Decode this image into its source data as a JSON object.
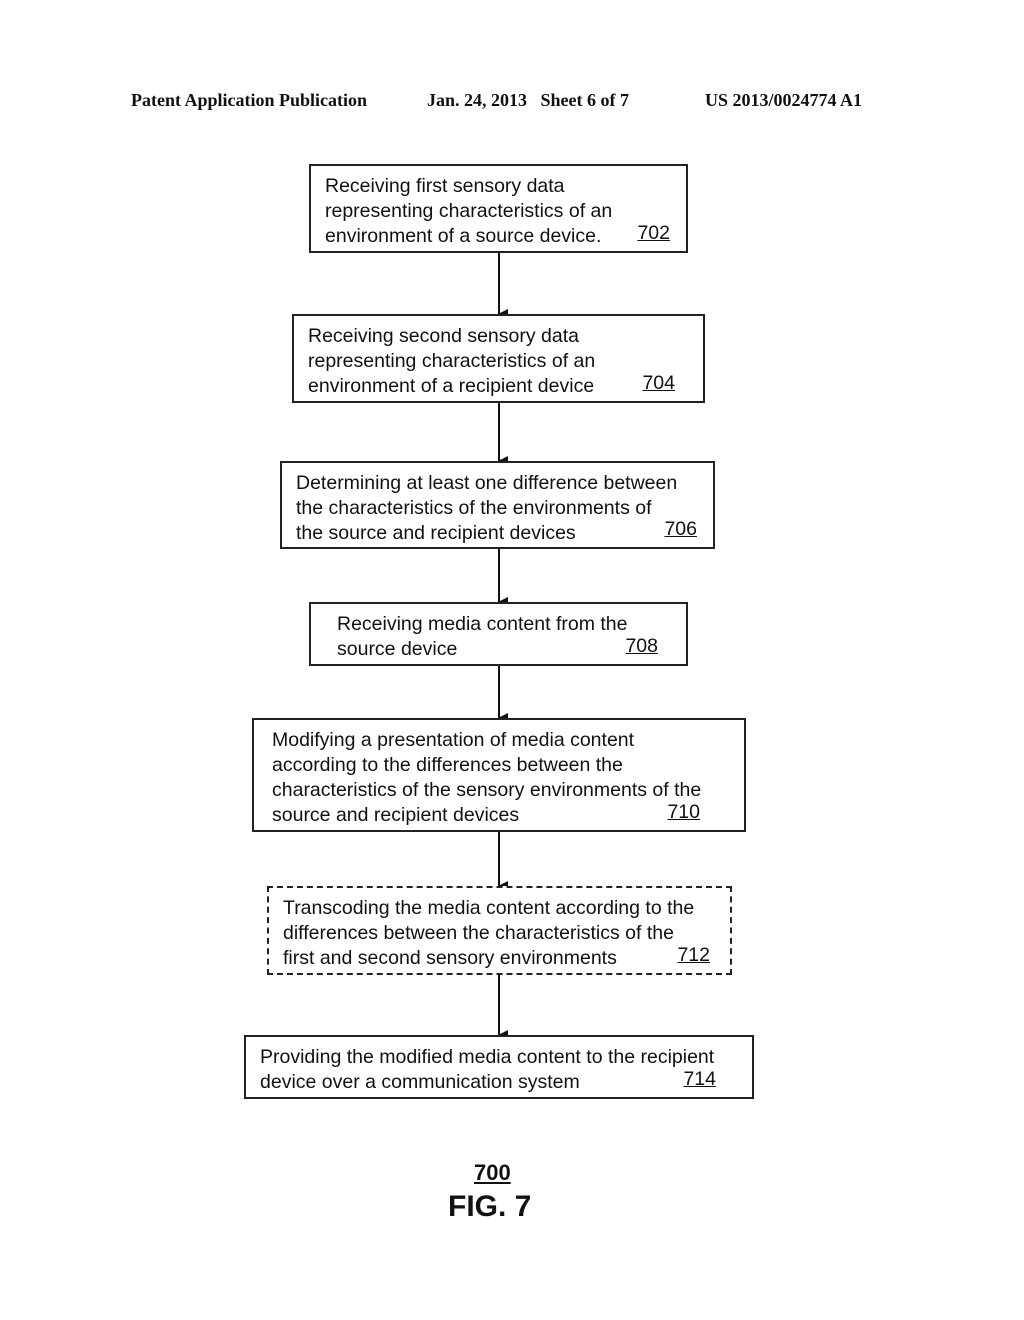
{
  "header": {
    "publication": "Patent Application Publication",
    "date_sheet": "Jan. 24, 2013   Sheet 6 of 7",
    "number": "US 2013/0024774 A1"
  },
  "flowchart": {
    "steps": [
      {
        "lines": [
          "Receiving first sensory data",
          "representing characteristics of an",
          "environment of a source device."
        ],
        "ref": "702",
        "optional": false
      },
      {
        "lines": [
          "Receiving second sensory data",
          "representing characteristics of an",
          "environment of a recipient device"
        ],
        "ref": "704",
        "optional": false
      },
      {
        "lines": [
          "Determining at least one difference between",
          "the characteristics of the environments of",
          "the source and recipient devices"
        ],
        "ref": "706",
        "optional": false
      },
      {
        "lines": [
          "Receiving media content from the",
          "source device"
        ],
        "ref": "708",
        "optional": false
      },
      {
        "lines": [
          "Modifying a presentation of media content",
          "according to the differences between the",
          "characteristics of the sensory environments of the",
          "source and recipient devices"
        ],
        "ref": "710",
        "optional": false
      },
      {
        "lines": [
          "Transcoding the media content according to the",
          "differences between the characteristics of the",
          "first and second sensory environments"
        ],
        "ref": "712",
        "optional": true
      },
      {
        "lines": [
          "Providing the modified media content to the recipient",
          "device over a communication system"
        ],
        "ref": "714",
        "optional": false
      }
    ]
  },
  "figure": {
    "ref": "700",
    "label": "FIG. 7"
  }
}
